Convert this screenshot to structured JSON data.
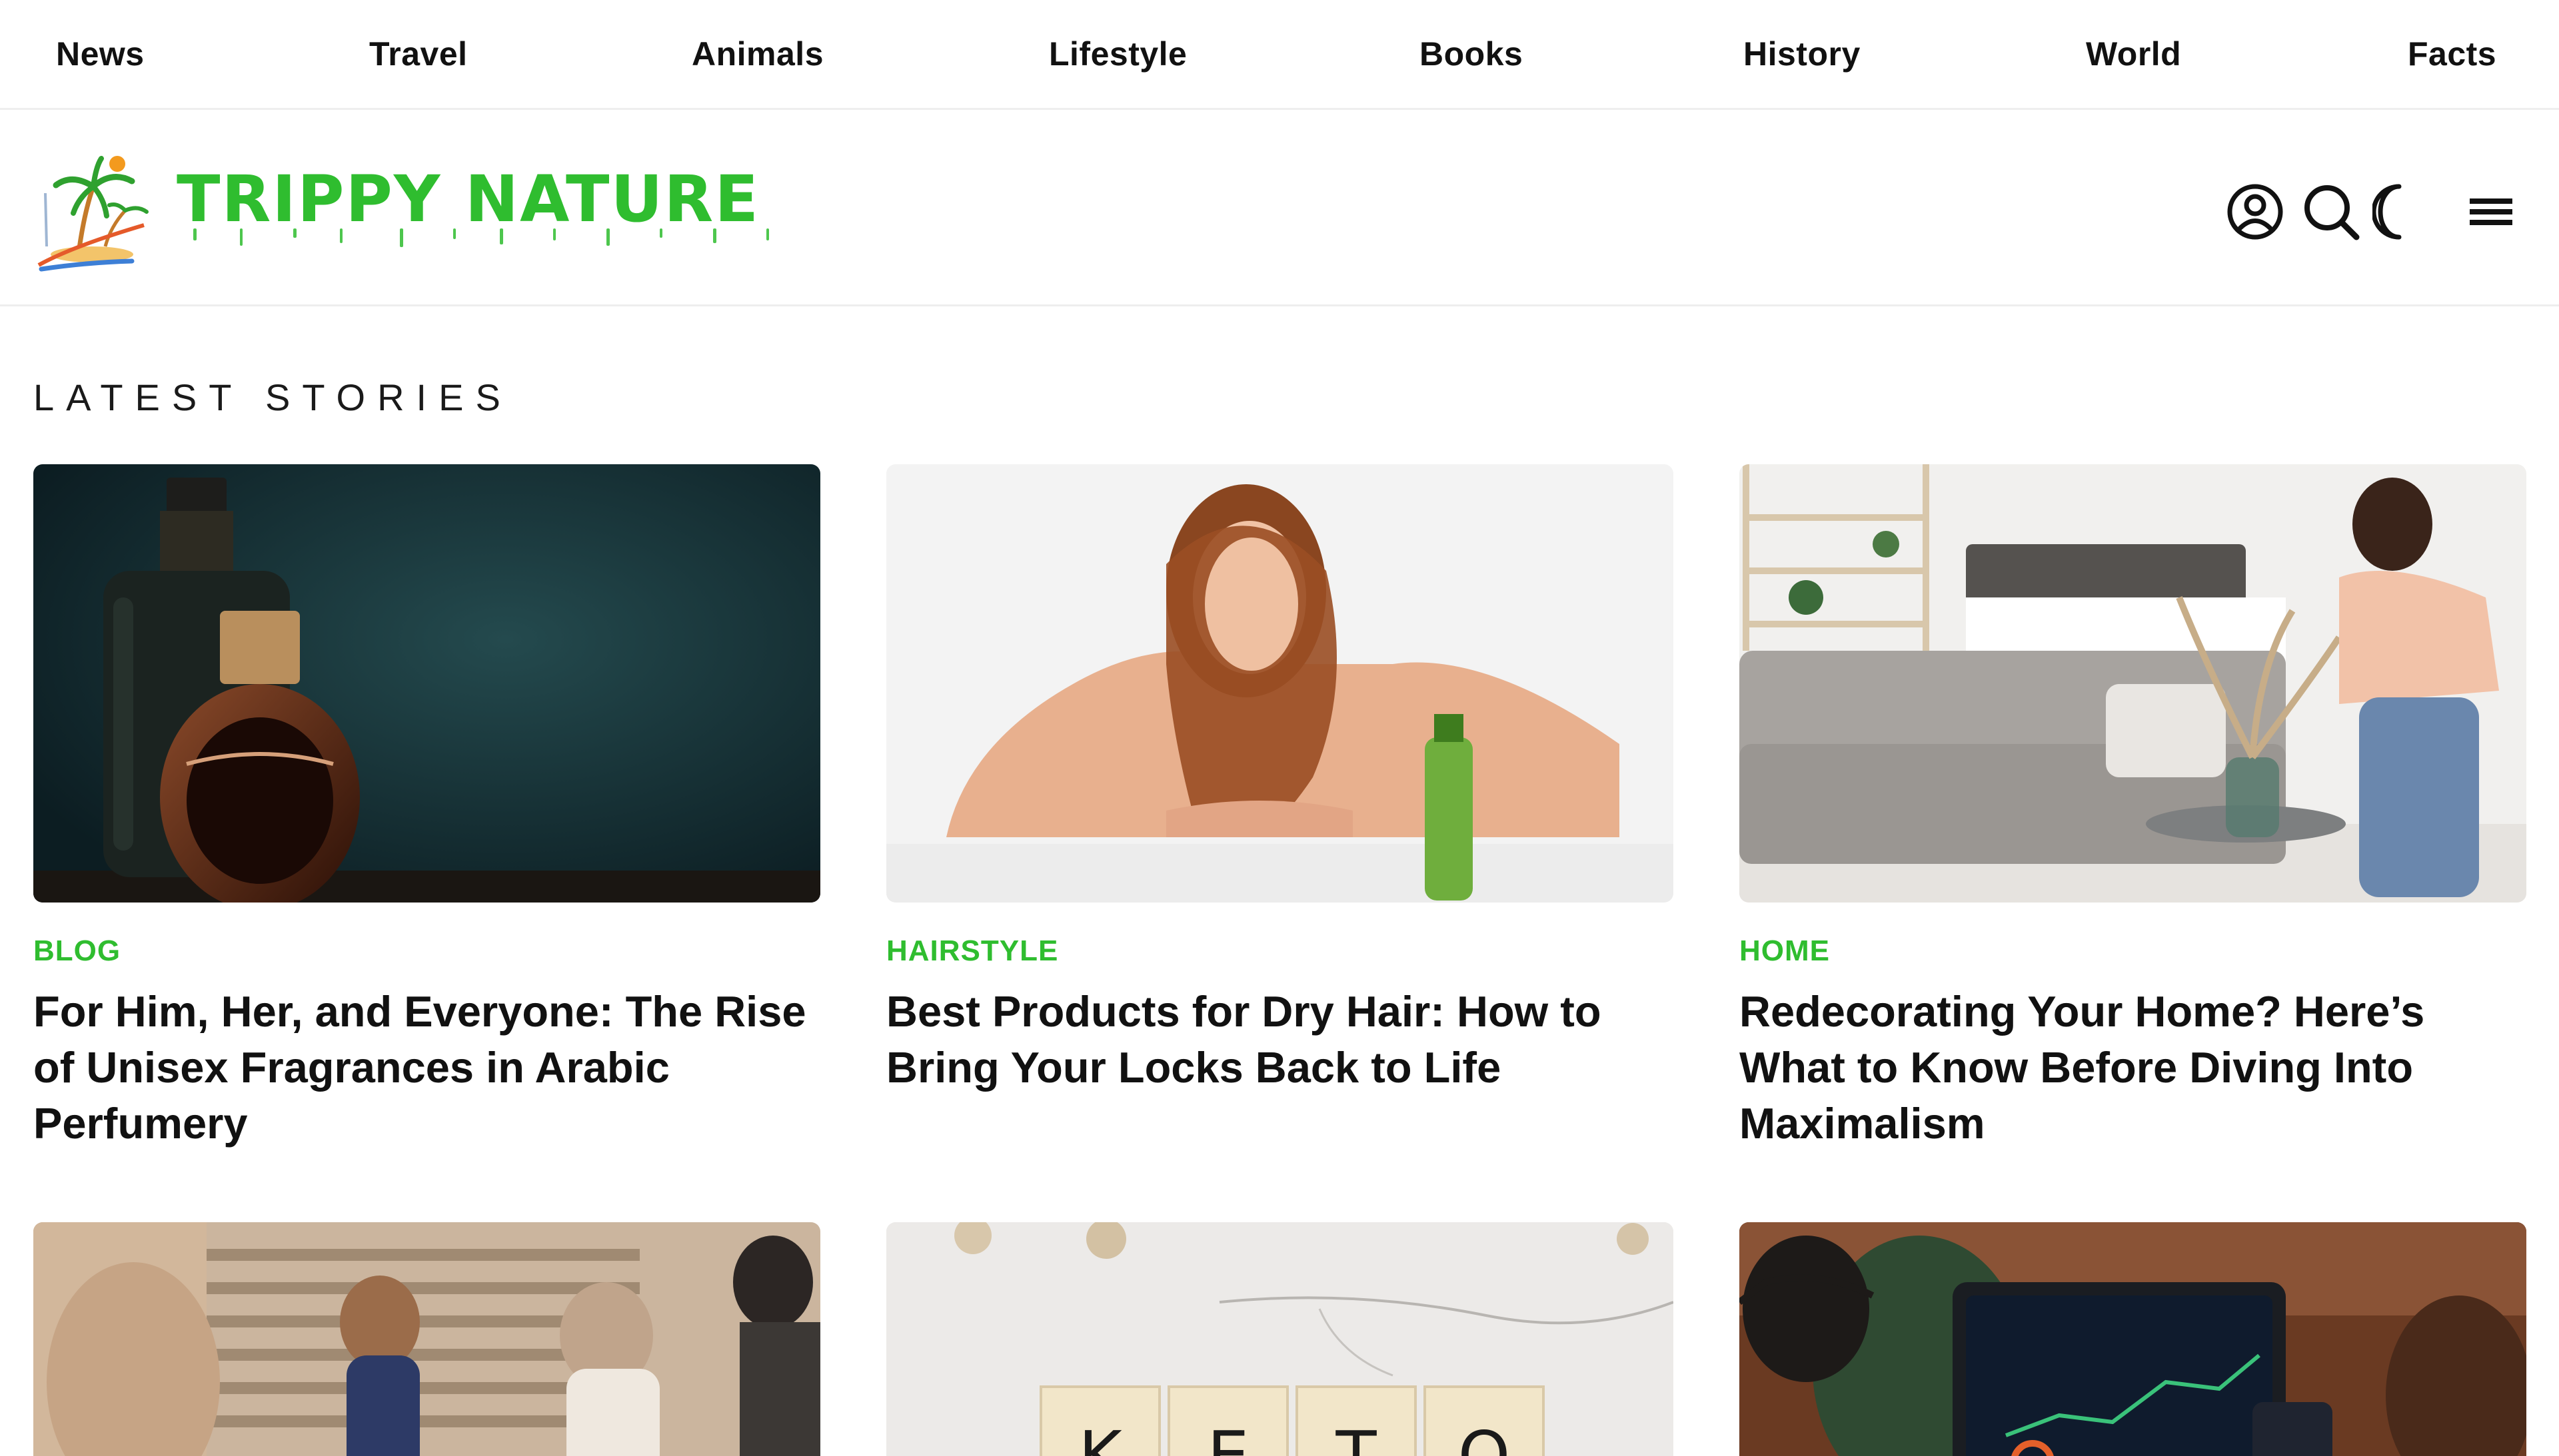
{
  "nav": {
    "items": [
      "News",
      "Travel",
      "Animals",
      "Lifestyle",
      "Books",
      "History",
      "World",
      "Facts"
    ]
  },
  "brand": {
    "name": "TRIPPY NATURE",
    "color": "#2fbd2f"
  },
  "header_icons": [
    "user-icon",
    "search-icon",
    "moon-icon",
    "menu-icon"
  ],
  "section": {
    "label": "LATEST STORIES"
  },
  "stories": [
    {
      "category": "BLOG",
      "title": "For Him, Her, and Everyone: The Rise of Unisex Fragrances in Arabic Perfumery"
    },
    {
      "category": "HAIRSTYLE",
      "title": "Best Products for Dry Hair: How to Bring Your Locks Back to Life"
    },
    {
      "category": "HOME",
      "title": "Redecorating Your Home? Here’s What to Know Before Diving Into Maximalism"
    }
  ],
  "stories_row2": {
    "keto_letters": [
      "K",
      "E",
      "T",
      "O"
    ]
  },
  "colors": {
    "accent": "#2fbd2f",
    "text": "#111111",
    "divider": "#eeeeee"
  }
}
